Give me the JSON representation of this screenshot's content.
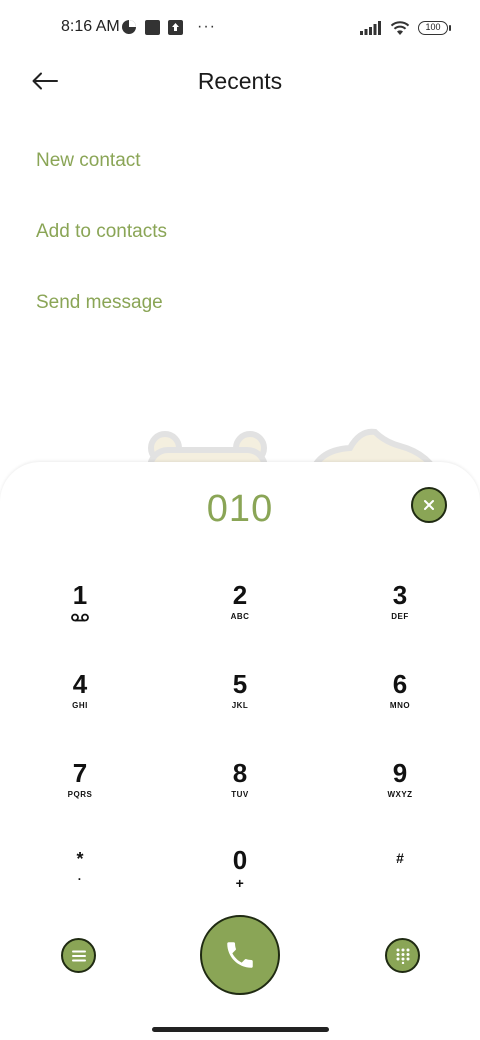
{
  "status_bar": {
    "time": "8:16 AM",
    "battery": "100",
    "icons": [
      "data-saver-icon",
      "square-notification-icon",
      "upload-notification-icon",
      "more-dots-icon",
      "signal-icon",
      "wifi-icon",
      "battery-icon"
    ],
    "dots": "···"
  },
  "header": {
    "title": "Recents",
    "back_icon": "back-arrow-icon"
  },
  "actions": {
    "new_contact": "New contact",
    "add_to_contacts": "Add to contacts",
    "send_message": "Send message"
  },
  "dialpad": {
    "dialed_number": "010",
    "keys": [
      {
        "digit": "1",
        "letters": ""
      },
      {
        "digit": "2",
        "letters": "ABC"
      },
      {
        "digit": "3",
        "letters": "DEF"
      },
      {
        "digit": "4",
        "letters": "GHI"
      },
      {
        "digit": "5",
        "letters": "JKL"
      },
      {
        "digit": "6",
        "letters": "MNO"
      },
      {
        "digit": "7",
        "letters": "PQRS"
      },
      {
        "digit": "8",
        "letters": "TUV"
      },
      {
        "digit": "9",
        "letters": "WXYZ"
      },
      {
        "digit": "*",
        "letters": "·"
      },
      {
        "digit": "0",
        "letters": "+"
      },
      {
        "digit": "#",
        "letters": ""
      }
    ]
  },
  "colors": {
    "accent": "#8aa556",
    "outline": "#1f2a12"
  }
}
